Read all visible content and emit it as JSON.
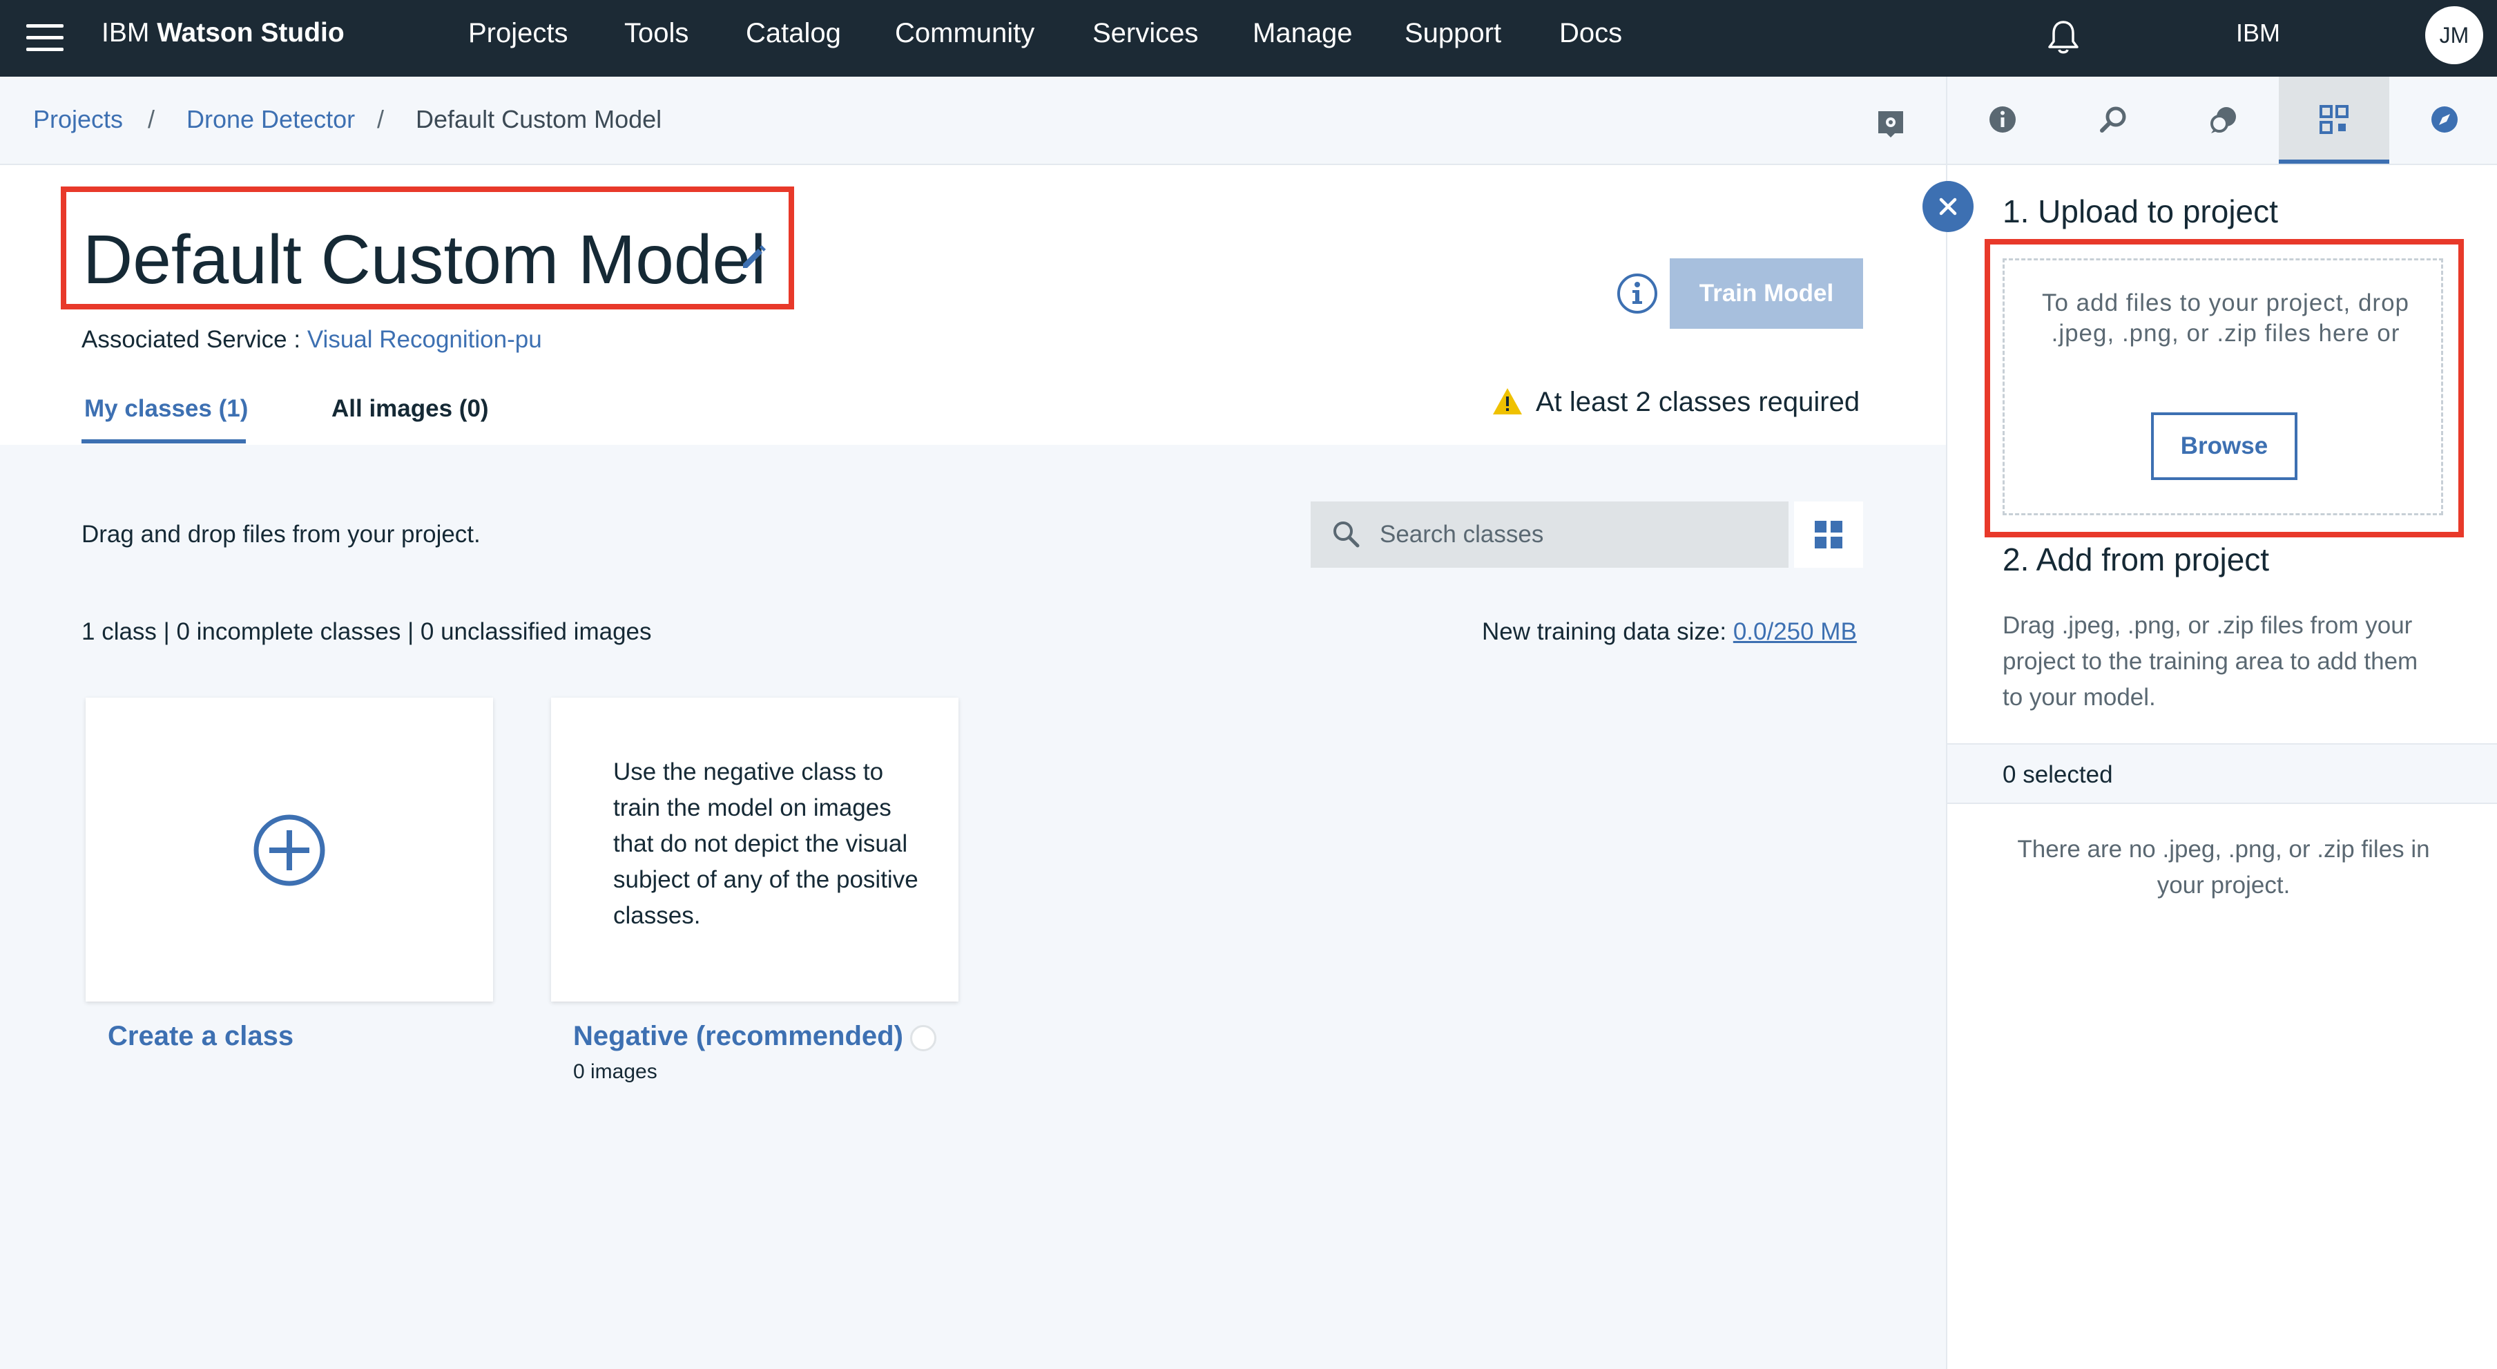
{
  "header": {
    "brand_prefix": "IBM",
    "brand_name": "Watson Studio",
    "nav": [
      "Projects",
      "Tools",
      "Catalog",
      "Community",
      "Services",
      "Manage",
      "Support",
      "Docs"
    ],
    "org": "IBM",
    "avatar_initials": "JM"
  },
  "breadcrumb": {
    "items": [
      "Projects",
      "Drone Detector",
      "Default Custom Model"
    ],
    "separator": "/"
  },
  "page": {
    "title": "Default Custom Model",
    "associated_label": "Associated Service :",
    "associated_service": "Visual Recognition-pu",
    "train_button": "Train Model",
    "tabs": [
      "My classes (1)",
      "All images (0)"
    ],
    "warning": "At least 2 classes required",
    "drag_hint": "Drag and drop files from your project.",
    "search_placeholder": "Search classes",
    "stats": "1 class | 0 incomplete classes | 0 unclassified images",
    "size_label": "New training data size:",
    "size_value": "0.0/250 MB",
    "cards": {
      "create_label": "Create a class",
      "negative_description": "Use the negative class to train the model on images that do not depict the visual subject of any of the positive classes.",
      "negative_label": "Negative (recommended)",
      "negative_count": "0 images"
    }
  },
  "panel": {
    "tools": [
      "info-icon",
      "search-history-icon",
      "chat-icon",
      "data-assets-icon",
      "compass-icon"
    ],
    "active_tool": "data-assets-icon",
    "upload_heading": "1. Upload to project",
    "drop_text": "To add files to your project, drop .jpeg, .png, or .zip files here or",
    "browse_button": "Browse",
    "add_heading": "2. Add from project",
    "add_description": "Drag .jpeg, .png, or .zip files from your project to the training area to add them to your model.",
    "selected": "0 selected",
    "empty_message": "There are no .jpeg, .png, or .zip files in your project."
  },
  "colors": {
    "topbar": "#1c2a35",
    "accent": "#3d70b2",
    "highlight": "#e8392a",
    "warning": "#efc100"
  }
}
